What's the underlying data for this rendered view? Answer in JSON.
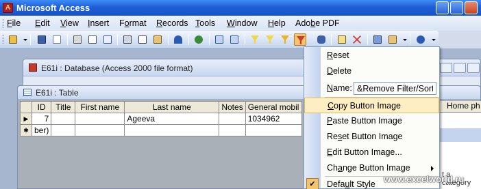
{
  "app": {
    "title": "Microsoft Access"
  },
  "menubar": [
    {
      "label": "File",
      "u": "F",
      "rest": "ile"
    },
    {
      "label": "Edit",
      "u": "E",
      "rest": "dit"
    },
    {
      "label": "View",
      "u": "V",
      "rest": "iew"
    },
    {
      "label": "Insert",
      "u": "I",
      "rest": "nsert"
    },
    {
      "label": "Format",
      "u": "o",
      "pre": "F",
      "rest": "rmat"
    },
    {
      "label": "Records",
      "u": "R",
      "rest": "ecords"
    },
    {
      "label": "Tools",
      "u": "T",
      "rest": "ools"
    },
    {
      "label": "Window",
      "u": "W",
      "rest": "indow"
    },
    {
      "label": "Help",
      "u": "H",
      "rest": "elp"
    },
    {
      "label": "Adobe PDF",
      "u": "b",
      "pre": "Ado",
      "rest": "e PDF"
    }
  ],
  "database_window": {
    "title": "E61i : Database (Access 2000 file format)"
  },
  "table_window": {
    "title": "E61i : Table",
    "columns": [
      "ID",
      "Title",
      "First name",
      "Last name",
      "Notes",
      "General mobil"
    ],
    "rows": [
      {
        "selector": "▶",
        "ID": "7",
        "Title": "",
        "First name": "",
        "Last name": "Ageeva",
        "Notes": "",
        "General mobil": "1034962"
      },
      {
        "selector": "✱",
        "ID": "ber)",
        "Title": "",
        "First name": "",
        "Last name": "",
        "Notes": "",
        "General mobil": ""
      }
    ]
  },
  "side_pane": {
    "header": "Home ph",
    "footer_text": "t a category"
  },
  "context_menu": {
    "items": [
      {
        "label": "Reset",
        "u": "R",
        "rest": "eset"
      },
      {
        "label": "Delete",
        "u": "D",
        "rest": "elete"
      },
      {
        "label": "Name:",
        "u": "N",
        "rest": "ame:",
        "value": "&Remove Filter/Sort"
      },
      {
        "label": "Copy Button Image",
        "u": "C",
        "rest": "opy Button Image",
        "highlighted": true
      },
      {
        "label": "Paste Button Image",
        "u": "P",
        "rest": "aste Button Image"
      },
      {
        "label": "Reset Button Image",
        "pre": "Re",
        "u": "s",
        "rest": "et Button Image"
      },
      {
        "label": "Edit Button Image...",
        "u": "E",
        "rest": "dit Button Image..."
      },
      {
        "label": "Change Button Image",
        "pre": "Ch",
        "u": "a",
        "rest": "nge Button Image"
      },
      {
        "label": "Default Style",
        "pre": "Defa",
        "u": "u",
        "rest": "lt Style",
        "checked": true
      }
    ]
  },
  "watermark": "www.excelworld.ru",
  "colors": {
    "titlebar": "#1f5fd6",
    "highlight": "#fdeec3",
    "active_button": "#f5c56e"
  }
}
